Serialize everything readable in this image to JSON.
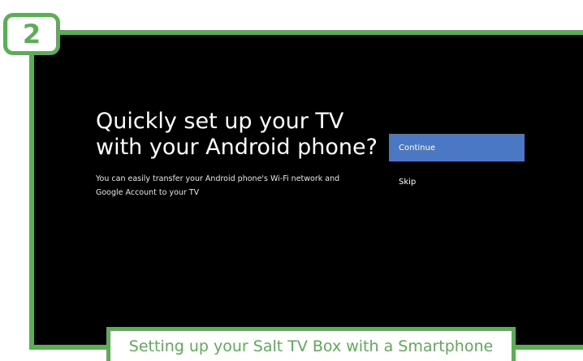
{
  "step": {
    "number": "2"
  },
  "screen": {
    "title": "Quickly set up your TV with your Android phone?",
    "description": "You can easily transfer your Android phone's Wi-Fi network and Google Account to your TV",
    "continue_label": "Continue",
    "skip_label": "Skip"
  },
  "caption": {
    "text": "Setting up your Salt TV Box with a Smartphone"
  },
  "colors": {
    "brand_green": "#5aae54",
    "focus_blue": "#4a78c4",
    "screen_bg": "#000000"
  }
}
